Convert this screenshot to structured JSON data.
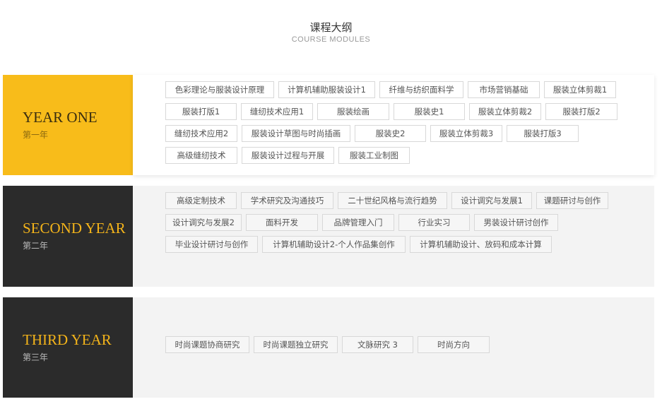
{
  "header": {
    "title": "课程大纲",
    "subtitle": "COURSE MODULES"
  },
  "years": [
    {
      "label": "YEAR ONE",
      "sublabel": "第一年",
      "panel_color": "#f8bc1a",
      "courses": [
        "色彩理论与服装设计原理",
        "计算机辅助服装设计1",
        "纤维与纺织面料学",
        "市场营销基础",
        "服装立体剪裁1",
        "服装打版1",
        "缝纫技术应用1",
        "服装绘画",
        "服装史1",
        "服装立体剪裁2",
        "服装打版2",
        "缝纫技术应用2",
        "服装设计草图与时尚插画",
        "服装史2",
        "服装立体剪裁3",
        "服装打版3",
        "高级缝纫技术",
        "服装设计过程与开展",
        "服装工业制图"
      ]
    },
    {
      "label": "SECOND YEAR",
      "sublabel": "第二年",
      "panel_color": "#2b2b2b",
      "courses": [
        "高级定制技术",
        "学术研究及沟通技巧",
        "二十世纪风格与流行趋势",
        "设计调究与发展1",
        "课题研讨与创作",
        "设计调究与发展2",
        "面料开发",
        "品牌管理入门",
        "行业实习",
        "男装设计研讨创作",
        "毕业设计研讨与创作",
        "计算机辅助设计2-个人作品集创作",
        "计算机辅助设计、放码和成本计算"
      ]
    },
    {
      "label": "THIRD YEAR",
      "sublabel": "第三年",
      "panel_color": "#2b2b2b",
      "courses": [
        "时尚课题协商研究",
        "时尚课题独立研究",
        "文脉研究 3",
        "时尚方向"
      ]
    }
  ],
  "colors": {
    "accent_yellow": "#f8bc1a",
    "dark_panel": "#2b2b2b",
    "tag_border": "#d8d8d8",
    "tag_text": "#555555"
  }
}
